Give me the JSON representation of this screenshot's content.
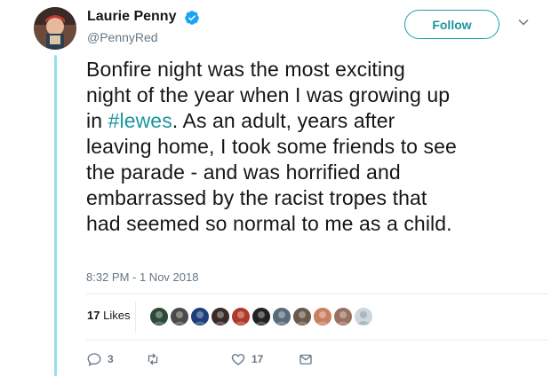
{
  "author": {
    "name": "Laurie Penny",
    "handle": "@PennyRed",
    "verified": true
  },
  "follow_button": {
    "label": "Follow"
  },
  "tweet": {
    "lines": [
      "Bonfire night was the most exciting",
      "night of the year when I was growing up",
      "in ",
      ". As an adult, years after",
      "leaving home, I took some friends to see",
      "the parade - and was horrified and",
      "embarrassed by the racist tropes that",
      "had seemed so normal to me as a child."
    ],
    "hashtag": "#lewes",
    "timestamp": "8:32 PM - 1 Nov 2018"
  },
  "stats": {
    "likes_number": "17",
    "likes_label": "Likes"
  },
  "actions": {
    "reply_count": "3",
    "retweet_count": "",
    "like_count": "17"
  },
  "colors": {
    "accent": "#1b95a0",
    "thread_line": "#8fe3e8",
    "secondary_text": "#657786",
    "verified_blue": "#1da1f2"
  },
  "likers": [
    {
      "icon": "liker-avatar-1",
      "bg": "#2b4a3a"
    },
    {
      "icon": "liker-avatar-2",
      "bg": "#4a4a4a"
    },
    {
      "icon": "liker-avatar-3",
      "bg": "#1d3f7a"
    },
    {
      "icon": "liker-avatar-4",
      "bg": "#3a2a2a"
    },
    {
      "icon": "liker-avatar-5",
      "bg": "#b03a2a"
    },
    {
      "icon": "liker-avatar-6",
      "bg": "#222222"
    },
    {
      "icon": "liker-avatar-7",
      "bg": "#5a6a7a"
    },
    {
      "icon": "liker-avatar-8",
      "bg": "#6a5a4a"
    },
    {
      "icon": "liker-avatar-9",
      "bg": "#c88060"
    },
    {
      "icon": "liker-avatar-10",
      "bg": "#9a7060"
    },
    {
      "icon": "liker-avatar-default",
      "bg": "#ccd6dd"
    }
  ]
}
